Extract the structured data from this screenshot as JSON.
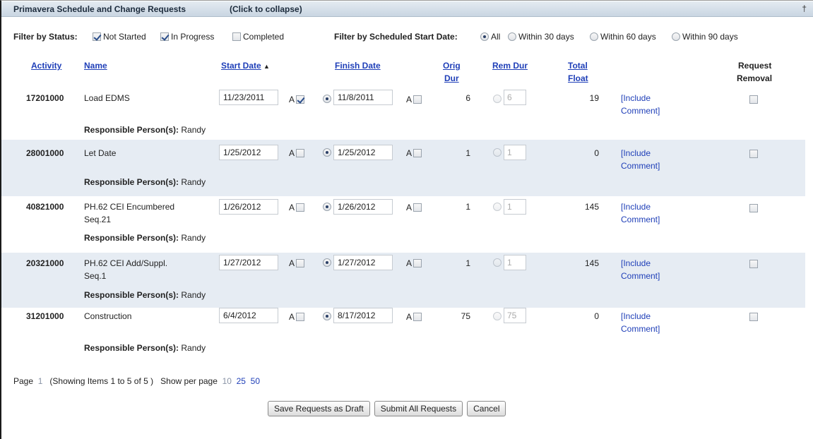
{
  "panel": {
    "title": "Primavera Schedule and Change Requests",
    "collapse_label": "(Click to collapse)",
    "pin_glyph": "†"
  },
  "filters": {
    "status_label": "Filter by Status:",
    "status_options": [
      {
        "label": "Not Started",
        "checked": true
      },
      {
        "label": "In Progress",
        "checked": true
      },
      {
        "label": "Completed",
        "checked": false
      }
    ],
    "date_label": "Filter by Scheduled Start Date:",
    "date_options": [
      {
        "label": "All",
        "selected": true
      },
      {
        "label": "Within 30 days",
        "selected": false
      },
      {
        "label": "Within 60 days",
        "selected": false
      },
      {
        "label": "Within 90 days",
        "selected": false
      }
    ]
  },
  "columns": {
    "activity": "Activity",
    "name": "Name",
    "start_date": "Start Date",
    "sort_glyph": "▲",
    "finish_date": "Finish Date",
    "orig_dur_1": "Orig",
    "orig_dur_2": "Dur",
    "rem_dur": "Rem Dur",
    "total_float_1": "Total",
    "total_float_2": "Float",
    "request_removal_1": "Request",
    "request_removal_2": "Removal"
  },
  "row_labels": {
    "actual": "A",
    "responsible_label": "Responsible Person(s):",
    "include_comment_1": "[Include",
    "include_comment_2": "Comment]"
  },
  "rows": [
    {
      "activity": "17201000",
      "name_1": "Load EDMS",
      "name_2": "",
      "start": "11/23/2011",
      "start_actual": true,
      "finish": "11/8/2011",
      "finish_actual": false,
      "orig_dur": "6",
      "rem_dur": "6",
      "total_float": "19",
      "responsible": "Randy"
    },
    {
      "activity": "28001000",
      "name_1": "Let Date",
      "name_2": "",
      "start": "1/25/2012",
      "start_actual": false,
      "finish": "1/25/2012",
      "finish_actual": false,
      "orig_dur": "1",
      "rem_dur": "1",
      "total_float": "0",
      "responsible": "Randy"
    },
    {
      "activity": "40821000",
      "name_1": "PH.62 CEI Encumbered",
      "name_2": "Seq.21",
      "start": "1/26/2012",
      "start_actual": false,
      "finish": "1/26/2012",
      "finish_actual": false,
      "orig_dur": "1",
      "rem_dur": "1",
      "total_float": "145",
      "responsible": "Randy"
    },
    {
      "activity": "20321000",
      "name_1": "PH.62 CEI Add/Suppl.",
      "name_2": "Seq.1",
      "start": "1/27/2012",
      "start_actual": false,
      "finish": "1/27/2012",
      "finish_actual": false,
      "orig_dur": "1",
      "rem_dur": "1",
      "total_float": "145",
      "responsible": "Randy"
    },
    {
      "activity": "31201000",
      "name_1": "Construction",
      "name_2": "",
      "start": "6/4/2012",
      "start_actual": false,
      "finish": "8/17/2012",
      "finish_actual": false,
      "orig_dur": "75",
      "rem_dur": "75",
      "total_float": "0",
      "responsible": "Randy"
    }
  ],
  "pager": {
    "page_label": "Page",
    "page_current": "1",
    "showing": "(Showing Items 1 to 5 of 5 )",
    "per_page_label": "Show per page",
    "per_page_options": [
      "10",
      "25",
      "50"
    ]
  },
  "buttons": {
    "save_draft": "Save Requests as Draft",
    "submit_all": "Submit All Requests",
    "cancel": "Cancel"
  }
}
